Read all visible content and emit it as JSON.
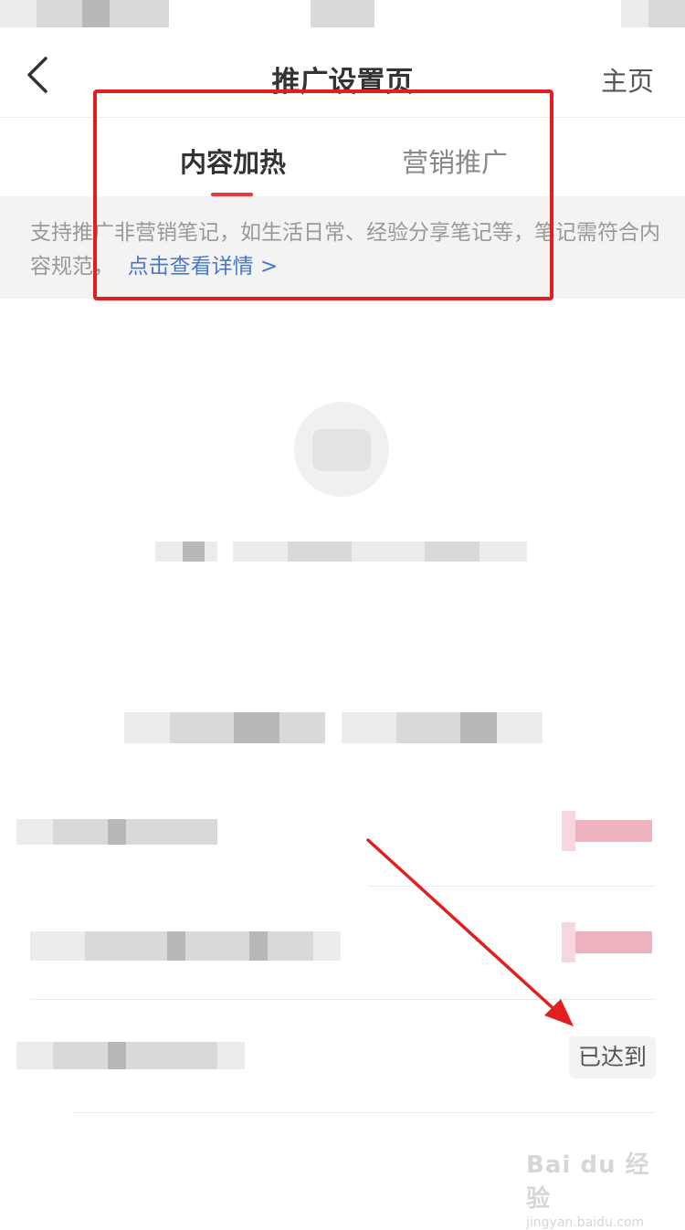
{
  "nav": {
    "title": "推广设置页",
    "home_label": "主页"
  },
  "tabs": [
    {
      "label": "内容加热",
      "active": true
    },
    {
      "label": "营销推广",
      "active": false
    }
  ],
  "notice": {
    "text": "支持推广非营销笔记，如生活日常、经验分享笔记等，笔记需符合内容规范，",
    "link_text": "点击查看详情 >"
  },
  "requirements": [
    {
      "status": ""
    },
    {
      "status": ""
    },
    {
      "status": "已达到"
    }
  ],
  "watermark": {
    "top": "Bai du 经验",
    "bottom": "jingyan.baidu.com"
  },
  "colors": {
    "accent": "#e5383f",
    "link": "#4a79c6",
    "annotation": "#e21f1f"
  }
}
